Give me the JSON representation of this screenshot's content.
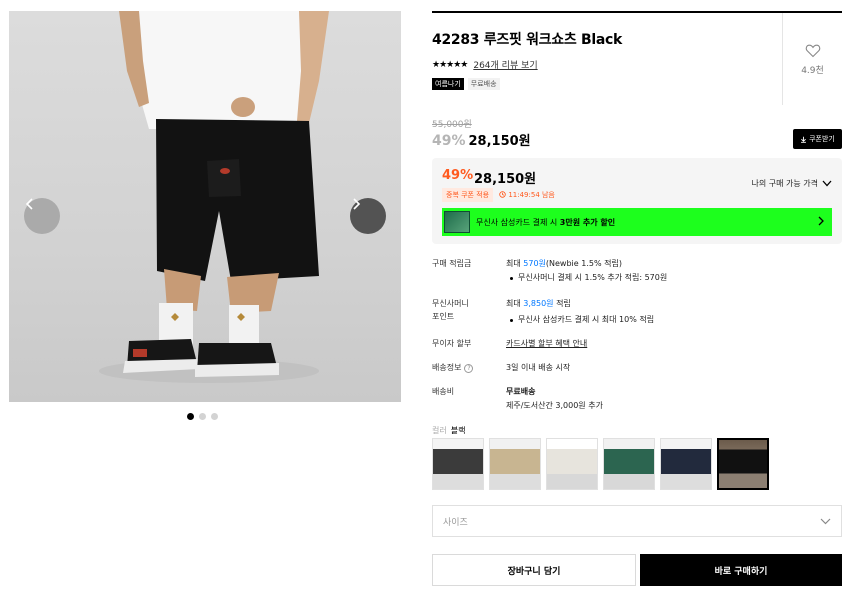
{
  "product": {
    "title": "42283 루즈핏 워크쇼츠 Black",
    "stars": "★★★★★",
    "review_link": "264개 리뷰 보기",
    "tags": [
      "여름나기",
      "무료배송"
    ],
    "like_count": "4.9천"
  },
  "price": {
    "original": "55,000원",
    "discount_rate": "49%",
    "current": "28,150원",
    "coupon_button": "쿠폰받기"
  },
  "promo": {
    "rate": "49%",
    "price": "28,150원",
    "my_price_label": "나의 구매 가능 가격",
    "coupon_applied": "중복 쿠폰 적용",
    "timer": "11:49:54 남음",
    "card_banner_prefix": "무신사 삼성카드 결제 시 ",
    "card_banner_bold": "3만원 추가 할인"
  },
  "details": {
    "points_label": "구매 적립금",
    "points_prefix": "최대 ",
    "points_amount": "570원",
    "points_suffix": "(Newbie 1.5% 적립)",
    "points_bullet": "무신사머니 결제 시 1.5% 추가 적립: 570원",
    "money_label_1": "무신사머니",
    "money_label_2": "포인트",
    "money_prefix": "최대 ",
    "money_amount": "3,850원",
    "money_suffix": " 적립",
    "money_bullet": "무신사 삼성카드 결제 시 최대 10% 적립",
    "installment_label": "무이자 할부",
    "installment_value": "카드사별 할부 혜택 안내",
    "shipping_info_label": "배송정보",
    "shipping_info_value": "3일 이내 배송 시작",
    "shipping_fee_label": "배송비",
    "shipping_fee_value": "무료배송",
    "shipping_fee_extra": "제주/도서산간 3,000원 추가"
  },
  "options": {
    "color_key": "컬러",
    "color_value": "블랙",
    "swatches": [
      "charcoal",
      "khaki",
      "white",
      "green",
      "navy",
      "black"
    ],
    "size_placeholder": "사이즈"
  },
  "actions": {
    "cart": "장바구니 담기",
    "buy": "바로 구매하기"
  },
  "colors": {
    "accent_orange": "#ff5a1f",
    "banner_green": "#1dff1d",
    "link_blue": "#0077ff"
  }
}
